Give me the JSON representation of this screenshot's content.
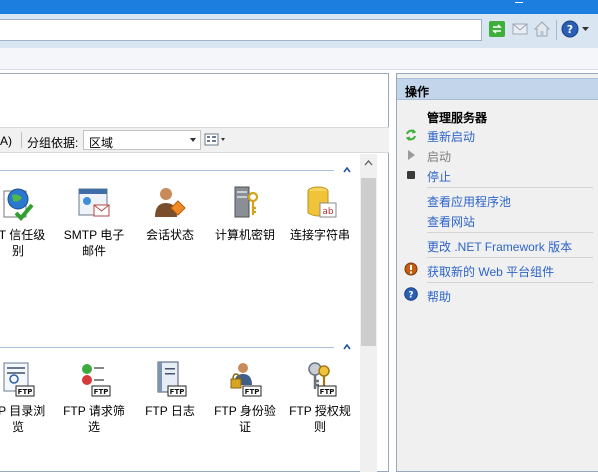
{
  "toolbar": {
    "icons": [
      "refresh-icon",
      "mail-icon",
      "home-icon",
      "help-icon"
    ]
  },
  "filter": {
    "prefix": "A)",
    "group_by_label": "分组依据:",
    "group_by_value": "区域"
  },
  "groups": [
    {
      "features": [
        {
          "label": "ET 信任级\n别",
          "icon": "trust-level-icon"
        },
        {
          "label": "SMTP 电子\n邮件",
          "icon": "smtp-email-icon"
        },
        {
          "label": "会话状态",
          "icon": "session-state-icon"
        },
        {
          "label": "计算机密钥",
          "icon": "machine-key-icon"
        },
        {
          "label": "连接字符串",
          "icon": "connection-string-icon"
        }
      ]
    },
    {
      "features": [
        {
          "label": "TP 目录浏\n览",
          "icon": "ftp-directory-browsing-icon"
        },
        {
          "label": "FTP 请求筛\n选",
          "icon": "ftp-request-filtering-icon"
        },
        {
          "label": "FTP 日志",
          "icon": "ftp-logging-icon"
        },
        {
          "label": "FTP 身份验\n证",
          "icon": "ftp-authentication-icon"
        },
        {
          "label": "FTP 授权规\n则",
          "icon": "ftp-authorization-rules-icon"
        }
      ]
    }
  ],
  "actions": {
    "title": "操作",
    "manage_server": "管理服务器",
    "restart": "重新启动",
    "start": "启动",
    "stop": "停止",
    "view_app_pools": "查看应用程序池",
    "view_sites": "查看网站",
    "change_net": "更改 .NET Framework 版本",
    "get_web_platform": "获取新的 Web 平台组件",
    "help": "帮助"
  },
  "colors": {
    "accent": "#1c7fe0",
    "link": "#2d64c8",
    "header": "#c3d5ea"
  }
}
